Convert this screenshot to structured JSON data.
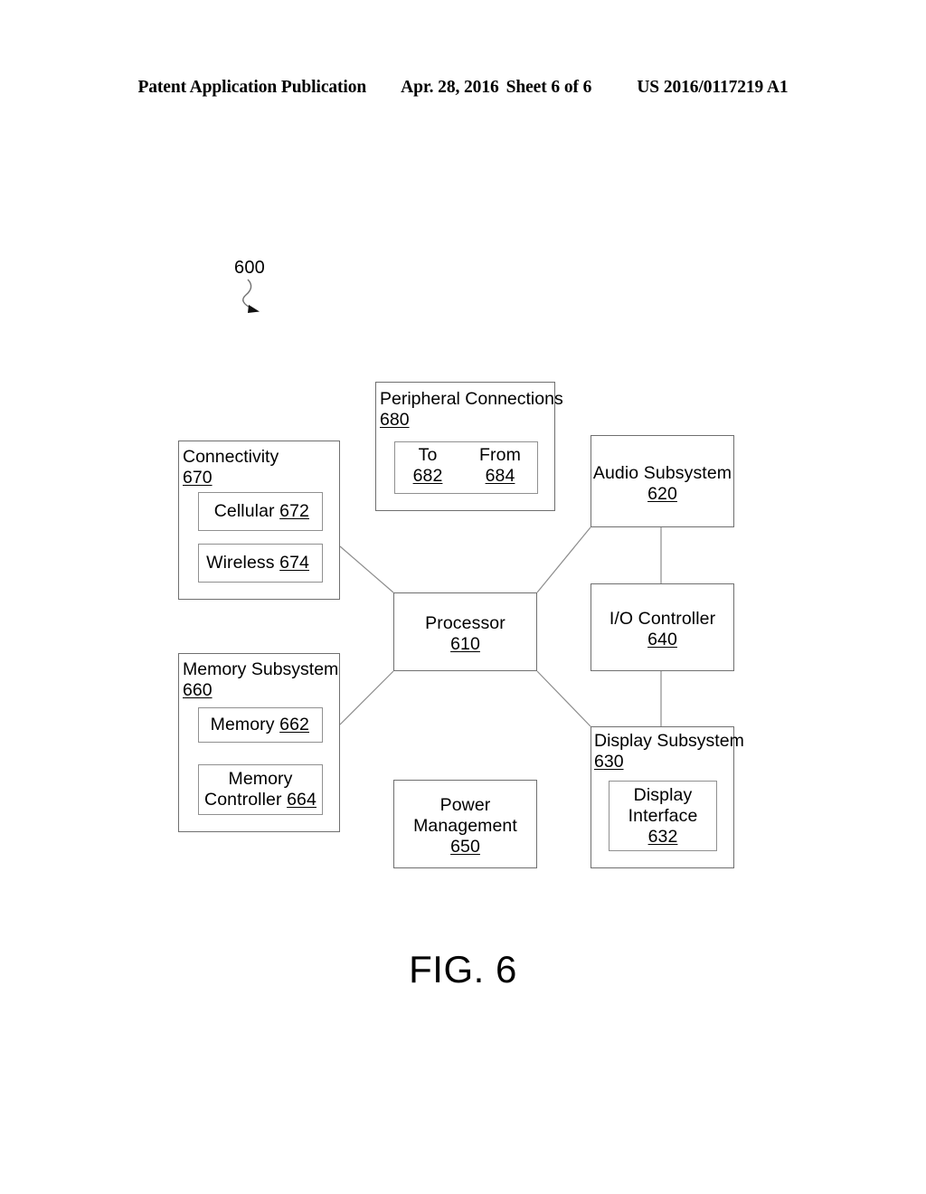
{
  "header": {
    "publication": "Patent Application Publication",
    "date": "Apr. 28, 2016",
    "sheet": "Sheet 6 of 6",
    "publication_number": "US 2016/0117219 A1"
  },
  "figure": {
    "reference_numeral": "600",
    "caption": "FIG. 6",
    "arrow_icon": "squiggle-arrow-icon",
    "line_color": "#6f6f6f",
    "inner_line_color": "#909090"
  },
  "blocks": {
    "peripheral_connections": {
      "title": "Peripheral Connections",
      "number": "680",
      "children": [
        {
          "title": "To",
          "number": "682"
        },
        {
          "title": "From",
          "number": "684"
        }
      ]
    },
    "connectivity": {
      "title": "Connectivity",
      "number": "670",
      "children": [
        {
          "label": "Cellular ",
          "number": "672"
        },
        {
          "label": "Wireless ",
          "number": "674"
        }
      ]
    },
    "audio_subsystem": {
      "title": "Audio Subsystem",
      "number": "620"
    },
    "processor": {
      "title": "Processor",
      "number": "610"
    },
    "io_controller": {
      "title": "I/O Controller",
      "number": "640"
    },
    "memory_subsystem": {
      "title": "Memory Subsystem",
      "number": "660",
      "children": [
        {
          "label": "Memory ",
          "number": "662"
        },
        {
          "line1": "Memory",
          "line2": "Controller ",
          "number": "664"
        }
      ]
    },
    "display_subsystem": {
      "title": "Display Subsystem",
      "number": "630",
      "children": [
        {
          "line1": "Display",
          "line2": "Interface",
          "number": "632"
        }
      ]
    },
    "power_management": {
      "line1": "Power",
      "line2": "Management",
      "number": "650"
    }
  },
  "connections": [
    {
      "from": "connectivity",
      "to": "processor"
    },
    {
      "from": "audio_subsystem",
      "to": "processor"
    },
    {
      "from": "memory_subsystem",
      "to": "processor"
    },
    {
      "from": "processor",
      "to": "display_subsystem"
    },
    {
      "from": "audio_subsystem",
      "to": "io_controller"
    },
    {
      "from": "io_controller",
      "to": "display_subsystem"
    }
  ]
}
